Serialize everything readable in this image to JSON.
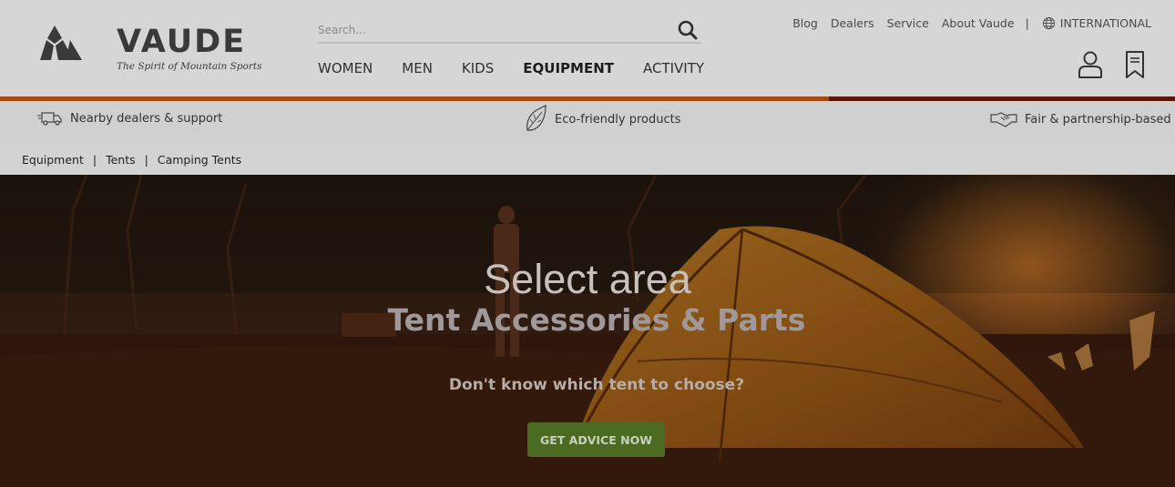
{
  "brand": {
    "name": "VAUDE",
    "tagline": "The Spirit of Mountain Sports"
  },
  "search": {
    "placeholder": "Search..."
  },
  "main_nav": [
    "WOMEN",
    "MEN",
    "KIDS",
    "EQUIPMENT",
    "ACTIVITY"
  ],
  "main_nav_active": "EQUIPMENT",
  "top_nav": {
    "blog": "Blog",
    "dealers": "Dealers",
    "service": "Service",
    "about": "About Vaude",
    "separator": "|",
    "international": "INTERNATIONAL"
  },
  "usp": [
    {
      "label": "Nearby dealers & support",
      "icon": "delivery-truck-icon"
    },
    {
      "label": "Eco-friendly products",
      "icon": "leaf-icon"
    },
    {
      "label": "Fair & partnership-based",
      "icon": "handshake-icon"
    }
  ],
  "breadcrumb": [
    "Equipment",
    "Tents",
    "Camping Tents"
  ],
  "hero": {
    "title": "Select area",
    "subtitle": "Tent Accessories & Parts",
    "question": "Don't know which tent to choose?",
    "cta": "GET ADVICE NOW"
  },
  "colors": {
    "accent_orange": "#a34b12",
    "accent_dark": "#5b1509",
    "cta_green": "#4b6a22",
    "header_bg": "#d6d6d6"
  }
}
